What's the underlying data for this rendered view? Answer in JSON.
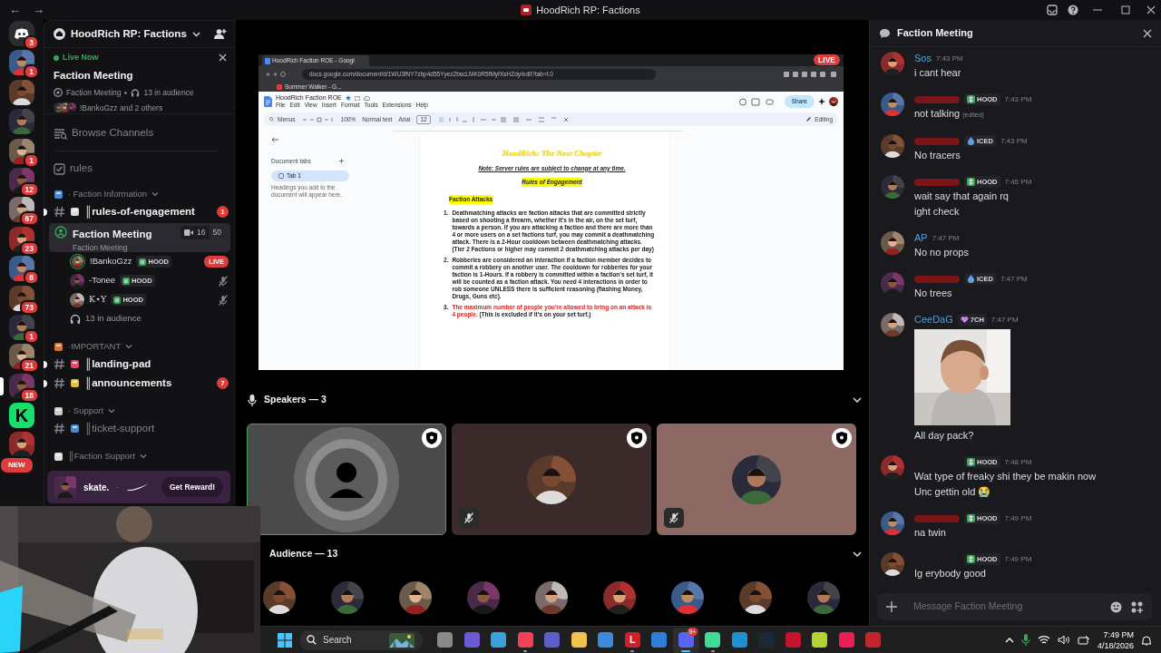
{
  "window": {
    "title": "HoodRich RP: Factions",
    "back": "←",
    "forward": "→"
  },
  "servers": [
    {
      "kind": "home",
      "badge": "3",
      "selected": false
    },
    {
      "kind": "picture",
      "badge": "1",
      "selected": false
    },
    {
      "kind": "picture",
      "selected": false
    },
    {
      "kind": "picture",
      "selected": false
    },
    {
      "kind": "picture",
      "badge": "1",
      "selected": false
    },
    {
      "kind": "picture",
      "badge": "12",
      "selected": false
    },
    {
      "kind": "picture",
      "badge": "67",
      "selected": false
    },
    {
      "kind": "picture",
      "badge": "23",
      "selected": false
    },
    {
      "kind": "picture",
      "badge": "8",
      "selected": false
    },
    {
      "kind": "picture",
      "badge": "73",
      "selected": false
    },
    {
      "kind": "picture",
      "badge": "1",
      "selected": false
    },
    {
      "kind": "picture",
      "badge": "21",
      "selected": false
    },
    {
      "kind": "picture",
      "badge": "18",
      "selected": true
    },
    {
      "kind": "letter",
      "label": "K",
      "selected": false
    },
    {
      "kind": "picture",
      "new_label": "NEW",
      "selected": false
    }
  ],
  "server_header": {
    "name": "HoodRich RP: Factions"
  },
  "live_now": {
    "label": "Live Now",
    "title": "Faction Meeting",
    "channel": "Faction Meeting",
    "audience": "13 in audience",
    "speakers": "!BankoGzz and 2 others"
  },
  "browse": {
    "label": "Browse Channels"
  },
  "channels": [
    {
      "kind": "rules",
      "name": "rules"
    },
    {
      "kind": "category",
      "name": "· Faction Information"
    },
    {
      "kind": "text",
      "name": "║rules-of-engagement",
      "unread": true,
      "mentions": "1"
    },
    {
      "kind": "stage",
      "name": "Faction Meeting",
      "topic": "Faction Meeting",
      "viewers": "16",
      "limit": "50",
      "selected": true
    },
    {
      "kind": "member",
      "name": "!BankoGzz",
      "tag": "HOOD",
      "live": "LIVE",
      "speaking": true,
      "muted": false
    },
    {
      "kind": "member",
      "name": "-Tonee",
      "tag": "HOOD",
      "speaking": false,
      "muted": true
    },
    {
      "kind": "member",
      "name": "K⋆Y",
      "tag": "HOOD",
      "speaking": false,
      "muted": true
    },
    {
      "kind": "audience",
      "name": "13 in audience"
    },
    {
      "kind": "category",
      "name": "·IMPORTANT"
    },
    {
      "kind": "text",
      "name": "║landing-pad",
      "unread": true
    },
    {
      "kind": "text",
      "name": "║announcements",
      "unread": true,
      "mentions": "7"
    },
    {
      "kind": "category",
      "name": "· Support"
    },
    {
      "kind": "text",
      "name": "║ticket-support",
      "unread": false
    },
    {
      "kind": "category",
      "name": "║Faction Support"
    }
  ],
  "promo": {
    "brand": "skate.",
    "separator": "·",
    "button": "Get Reward!"
  },
  "screen_share": {
    "live_badge": "LIVE",
    "browser": {
      "tab": "HoodRich Faction ROE - Googl",
      "url": "docs.google.com/document/d/1WU3fNY7zbp4d55Yyez2bscLMK0R5fMyfXsHZdy/edit?tab=t.0",
      "bookmark": "Summer Walker - G..."
    },
    "docs": {
      "title": "HoodRich Faction ROE",
      "menus": [
        "File",
        "Edit",
        "View",
        "Insert",
        "Format",
        "Tools",
        "Extensions",
        "Help"
      ],
      "share": "Share",
      "search": "Menus",
      "zoom": "100%",
      "style": "Normal text",
      "font": "Arial",
      "size": "12",
      "mode": "Editing",
      "outline": {
        "heading": "Document tabs",
        "tab": "Tab 1",
        "hint": "Headings you add to the document will appear here."
      },
      "page": {
        "title": "HoodRich: The Next Chapter",
        "note": "Note: Server rules are subject to change at any time.",
        "heading": "Rules of Engagement",
        "section": "Faction Attacks",
        "items": [
          {
            "number": "1.",
            "text": "Deathmatching attacks are faction attacks that are committed strictly based on shooting a firearm, whether it's in the air, on the set turf, towards a person. If you are attacking a faction and there are more than 4 or more users on a set factions turf, you may commit a deathmatching attack. There is a 2-Hour cooldown between deathmatching attacks. (Tier 2 Factions or higher may commit 2 deathmatching attacks per day)",
            "warning": false
          },
          {
            "number": "2.",
            "text": "Robberies are considered an interaction if a faction member decides to commit a robbery on another user. The cooldown for robberies for your faction is 1-Hours. If a robbery is committed within a faction's set turf, it will be counted as a faction attack. You need 4 interactions in order to rob someone UNLESS there is sufficient reasoning (flashing Money, Drugs, Guns etc).",
            "warning": false
          },
          {
            "number": "3.",
            "text": "The maximum number of people you're allowed to bring on an attack is 4 people.",
            "note": "(This is excluded if it's on your set turf.)",
            "warning": true
          }
        ]
      }
    }
  },
  "speakers": {
    "heading": "Speakers — 3",
    "tiles": [
      {
        "color": "#4a4a4a",
        "kind": "placeholder",
        "speaking": true,
        "muted": false,
        "moderator": true
      },
      {
        "color": "#3a2a2a",
        "kind": "picture",
        "speaking": false,
        "muted": true,
        "moderator": true
      },
      {
        "color": "#8c6a63",
        "kind": "picture",
        "speaking": false,
        "muted": true,
        "moderator": true
      }
    ]
  },
  "audience": {
    "heading": "Audience — 13",
    "members": [
      {
        "kind": "picture"
      },
      {
        "kind": "picture"
      },
      {
        "kind": "picture"
      },
      {
        "kind": "picture"
      },
      {
        "kind": "picture"
      },
      {
        "kind": "picture"
      },
      {
        "kind": "picture"
      },
      {
        "kind": "picture"
      },
      {
        "kind": "picture"
      }
    ]
  },
  "chat": {
    "title": "Faction Meeting",
    "messages": [
      {
        "author": "Sos",
        "color": "#4aa3df",
        "time": "7:43 PM",
        "lines": [
          "i cant hear"
        ]
      },
      {
        "color": "#7a1518",
        "badge": {
          "kind": "hood",
          "label": "HOOD"
        },
        "time": "7:43 PM",
        "lines": [
          "not talking"
        ],
        "edited": "(edited)"
      },
      {
        "color": "#7a1518",
        "badge": {
          "kind": "iced",
          "label": "ICED"
        },
        "time": "7:43 PM",
        "lines": [
          "No tracers"
        ]
      },
      {
        "color": "#7a1518",
        "badge": {
          "kind": "hood",
          "label": "HOOD"
        },
        "time": "7:45 PM",
        "lines": [
          "wait say that again rq",
          "ight check"
        ]
      },
      {
        "author": "AP",
        "color": "#4aa3df",
        "time": "7:47 PM",
        "lines": [
          "No no props"
        ]
      },
      {
        "color": "#7a1518",
        "badge": {
          "kind": "iced",
          "label": "ICED"
        },
        "time": "7:47 PM",
        "lines": [
          "No trees"
        ]
      },
      {
        "author": "CeeDaG",
        "color": "#4aa3df",
        "badge": {
          "kind": "heart",
          "label": "7CH"
        },
        "time": "7:47 PM",
        "attachment": {
          "kind": "picture"
        },
        "lines": [
          "All day pack?"
        ]
      },
      {
        "badge": {
          "kind": "hood",
          "label": "HOOD"
        },
        "time": "7:48 PM",
        "lines": [
          "Wat type of freaky shi they be makin now",
          "Unc gettin old 😭"
        ]
      },
      {
        "color": "#7a1518",
        "badge": {
          "kind": "hood",
          "label": "HOOD"
        },
        "time": "7:49 PM",
        "lines": [
          "na twin"
        ]
      },
      {
        "badge": {
          "kind": "hood",
          "label": "HOOD"
        },
        "time": "7:49 PM",
        "lines": [
          "Ig erybody good"
        ]
      }
    ],
    "composer": {
      "placeholder": "Message Faction Meeting"
    }
  },
  "taskbar": {
    "search": {
      "placeholder": "Search"
    },
    "apps": [
      {
        "color": "#8a8a8a",
        "running": false,
        "selected": false
      },
      {
        "color": "#6b5bd6",
        "running": false,
        "selected": false
      },
      {
        "color": "#3aa0e0",
        "running": false,
        "selected": false
      },
      {
        "color": "#f0405a",
        "running": true,
        "selected": false
      },
      {
        "color": "#5b5fc7",
        "running": false,
        "selected": false
      },
      {
        "color": "#f2c14e",
        "running": false,
        "selected": false
      },
      {
        "color": "#3d8bd9",
        "running": false,
        "selected": false
      },
      {
        "color": "#d21f26",
        "label": "L",
        "running": true,
        "selected": false
      },
      {
        "color": "#2f7fd8",
        "running": false,
        "selected": false
      },
      {
        "color": "#5865f2",
        "badge": "9+",
        "running": true,
        "selected": true
      },
      {
        "color": "#3ddc97",
        "running": true,
        "selected": false
      },
      {
        "color": "#1e90d6",
        "running": false,
        "selected": false
      },
      {
        "color": "#1b2838",
        "running": false,
        "selected": false
      },
      {
        "color": "#c4122f",
        "running": false,
        "selected": false
      },
      {
        "color": "#b5d334",
        "running": false,
        "selected": false
      },
      {
        "color": "#ee1d52",
        "running": false,
        "selected": false
      },
      {
        "color": "#c0262b",
        "running": false,
        "selected": false
      }
    ],
    "time": "7:49 PM",
    "date": "4/18/2026"
  }
}
